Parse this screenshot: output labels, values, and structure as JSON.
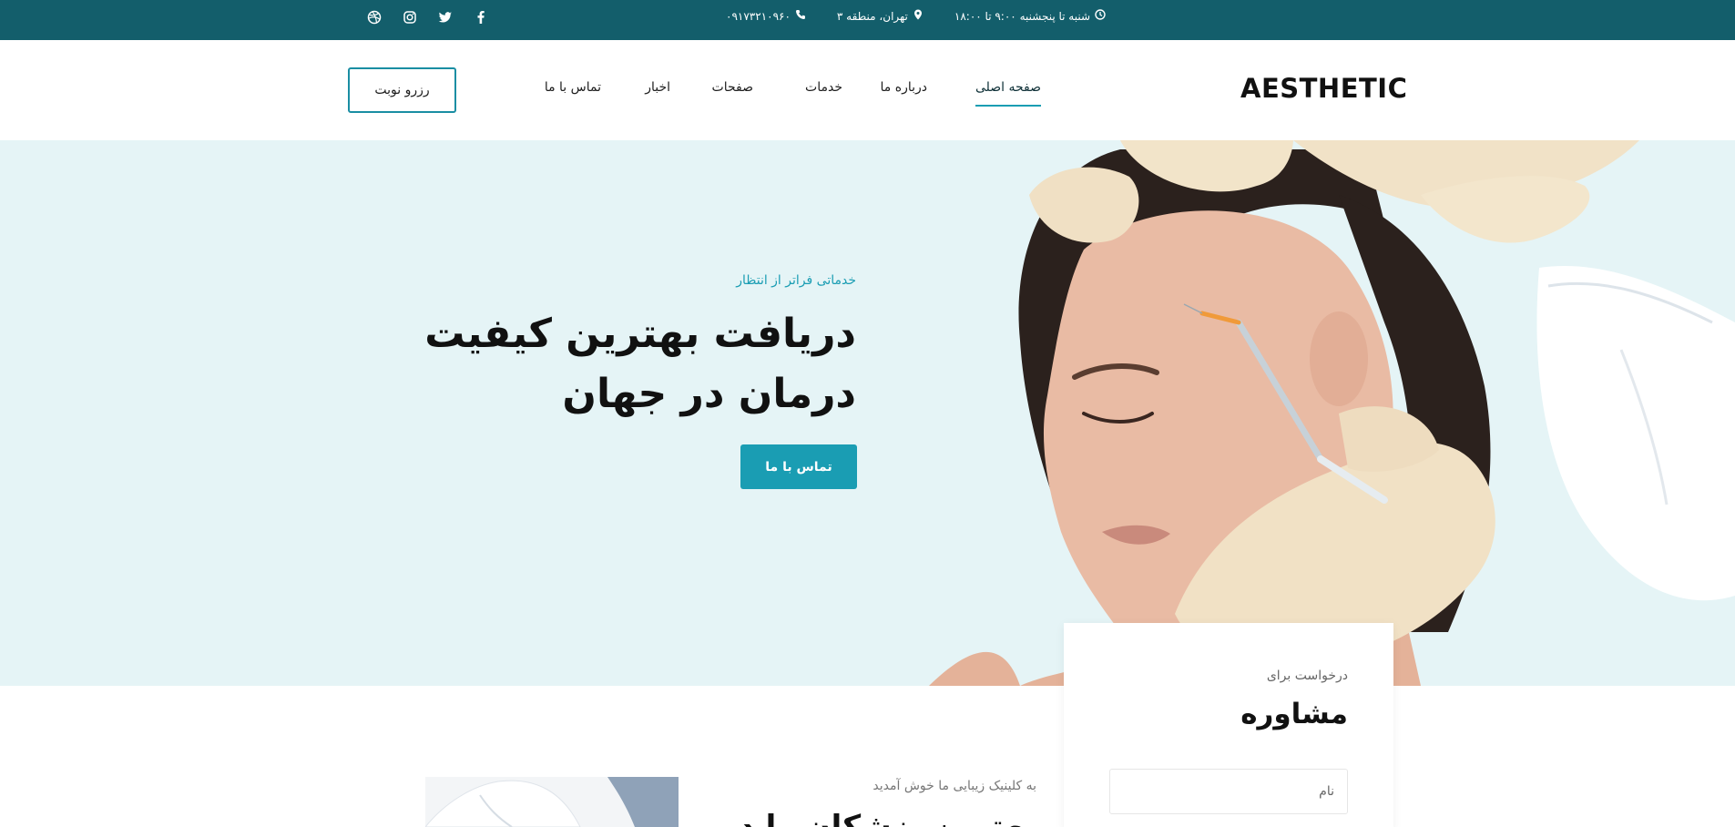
{
  "topbar": {
    "phone": "۰۹۱۷۳۲۱۰۹۶۰",
    "address": "تهران، منطقه ۳",
    "hours": "شنبه تا پنجشنبه ۹:۰۰ تا ۱۸:۰۰",
    "social": [
      "dribbble-icon",
      "instagram-icon",
      "twitter-icon",
      "facebook-icon"
    ]
  },
  "header": {
    "logo": "AESTHETIC",
    "nav": [
      {
        "label": "صفحه اصلی",
        "active": true
      },
      {
        "label": "درباره ما",
        "active": false
      },
      {
        "label": "خدمات",
        "active": false
      },
      {
        "label": "صفحات",
        "active": false
      },
      {
        "label": "اخبار",
        "active": false
      },
      {
        "label": "تماس با ما",
        "active": false
      }
    ],
    "book_label": "رزرو نوبت"
  },
  "hero": {
    "subtitle": "خدماتی فراتر از انتظار",
    "title": "دریافت بهترین کیفیت درمان در جهان",
    "button_label": "تماس با ما"
  },
  "consult": {
    "subtitle": "درخواست برای",
    "title": "مشاوره",
    "name_placeholder": "نام"
  },
  "welcome": {
    "subtitle": "به کلینیک زیبایی ما خوش آمدید",
    "title": "بهترین پزشکان را در"
  },
  "colors": {
    "topbar_bg": "#135e6b",
    "accent": "#1a9db3",
    "hero_bg": "#e5f4f6"
  }
}
